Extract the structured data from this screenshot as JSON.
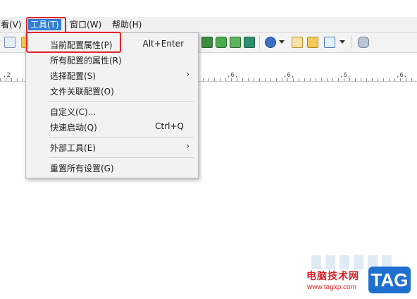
{
  "menubar": {
    "items": [
      {
        "label": "看(V)"
      },
      {
        "label": "工具(T)"
      },
      {
        "label": "窗口(W)"
      },
      {
        "label": "帮助(H)"
      }
    ]
  },
  "ruler": {
    "labels": [
      ",2",
      ",6,",
      ",6,",
      ",6,",
      ",6,",
      ",6,"
    ]
  },
  "tools_menu": {
    "items": [
      {
        "label": "当前配置属性(P)",
        "shortcut": "Alt+Enter"
      },
      {
        "label": "所有配置的属性(R)",
        "shortcut": ""
      },
      {
        "label": "选择配置(S)",
        "shortcut": ""
      },
      {
        "label": "文件关联配置(O)",
        "shortcut": ""
      },
      {
        "label": "自定义(C)...",
        "shortcut": ""
      },
      {
        "label": "快速启动(Q)",
        "shortcut": "Ctrl+Q"
      },
      {
        "label": "外部工具(E)",
        "shortcut": ""
      },
      {
        "label": "重置所有设置(G)",
        "shortcut": ""
      }
    ],
    "submenu_arrow": "›"
  },
  "watermark": {
    "title": "电脑技术网",
    "url": "www.tagxp.com",
    "logo": "TAG"
  },
  "colors": {
    "highlight": "#e0242b",
    "menu_active": "#2e7ed6",
    "brand": "#1f6fd1"
  },
  "icons": [
    "copy-icon",
    "folder-icon",
    "save-icon",
    "green-grid-icon",
    "refresh-icon",
    "sync-icon",
    "export-icon",
    "globe-icon",
    "dropdown-arrow-icon",
    "edit-icon",
    "tools-icon",
    "chart-icon",
    "dropdown-arrow-icon",
    "pin-icon"
  ]
}
